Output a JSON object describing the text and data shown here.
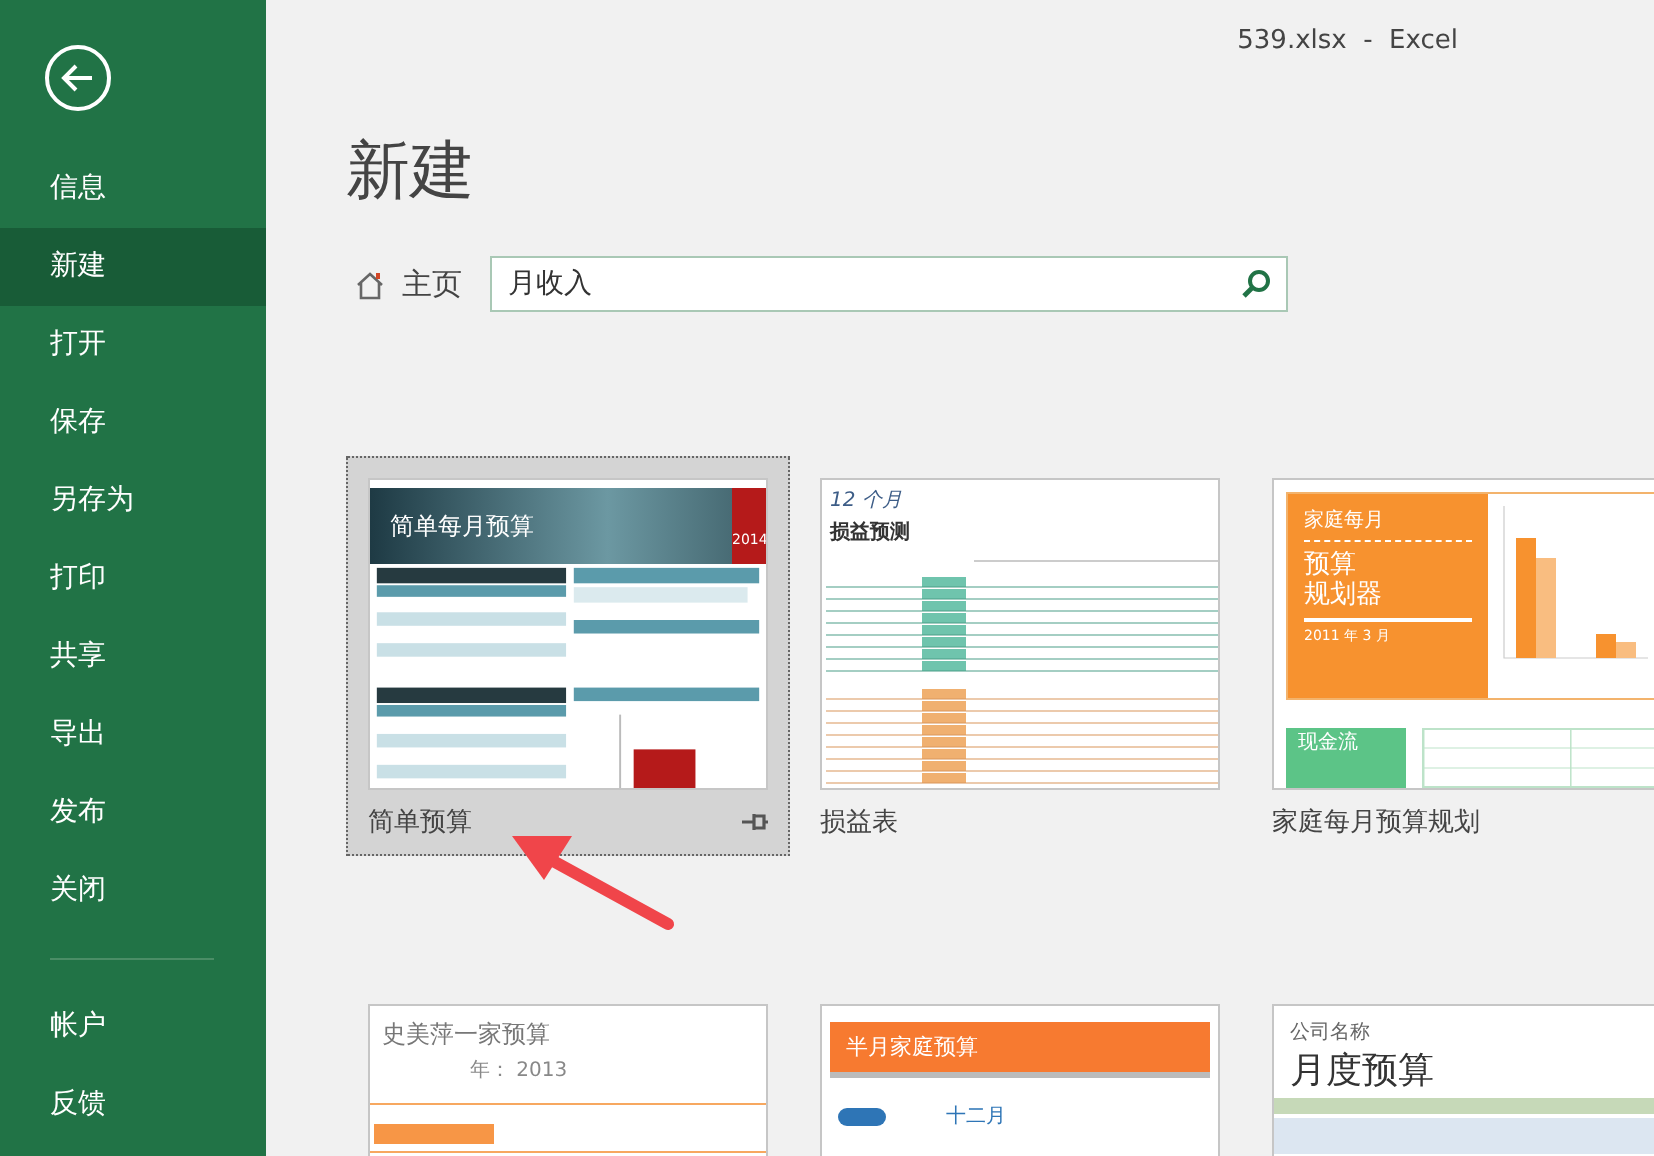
{
  "window": {
    "title": "539.xlsx  -  Excel"
  },
  "sidebar": {
    "items": [
      {
        "label": "信息",
        "selected": false
      },
      {
        "label": "新建",
        "selected": true
      },
      {
        "label": "打开",
        "selected": false
      },
      {
        "label": "保存",
        "selected": false
      },
      {
        "label": "另存为",
        "selected": false
      },
      {
        "label": "打印",
        "selected": false
      },
      {
        "label": "共享",
        "selected": false
      },
      {
        "label": "导出",
        "selected": false
      },
      {
        "label": "发布",
        "selected": false
      },
      {
        "label": "关闭",
        "selected": false
      }
    ],
    "footer_items": [
      {
        "label": "帐户",
        "selected": false
      },
      {
        "label": "反馈",
        "selected": false
      }
    ]
  },
  "heading": "新建",
  "search": {
    "home_label": "主页",
    "value": "月收入"
  },
  "templates": [
    {
      "name": "简单预算",
      "selected": true,
      "preview": {
        "kind": "simple-budget",
        "title": "简单每月预算",
        "year": "2014"
      }
    },
    {
      "name": "损益表",
      "selected": false,
      "preview": {
        "kind": "profit-loss",
        "caption": "12 个月",
        "title": "损益预测"
      }
    },
    {
      "name": "家庭每月预算规划",
      "selected": false,
      "preview": {
        "kind": "planner",
        "eyebrow": "家庭每月",
        "title_lines": [
          "预算",
          "规划器"
        ],
        "date": "2011 年 3 月",
        "tag": "现金流"
      }
    },
    {
      "selected": false,
      "preview": {
        "kind": "family",
        "title": "史美萍一家预算",
        "year": "年： 2013"
      }
    },
    {
      "selected": false,
      "preview": {
        "kind": "half-month",
        "title": "半月家庭预算",
        "month": "十二月"
      }
    },
    {
      "selected": false,
      "preview": {
        "kind": "company",
        "company": "公司名称",
        "title": "月度预算"
      }
    }
  ]
}
